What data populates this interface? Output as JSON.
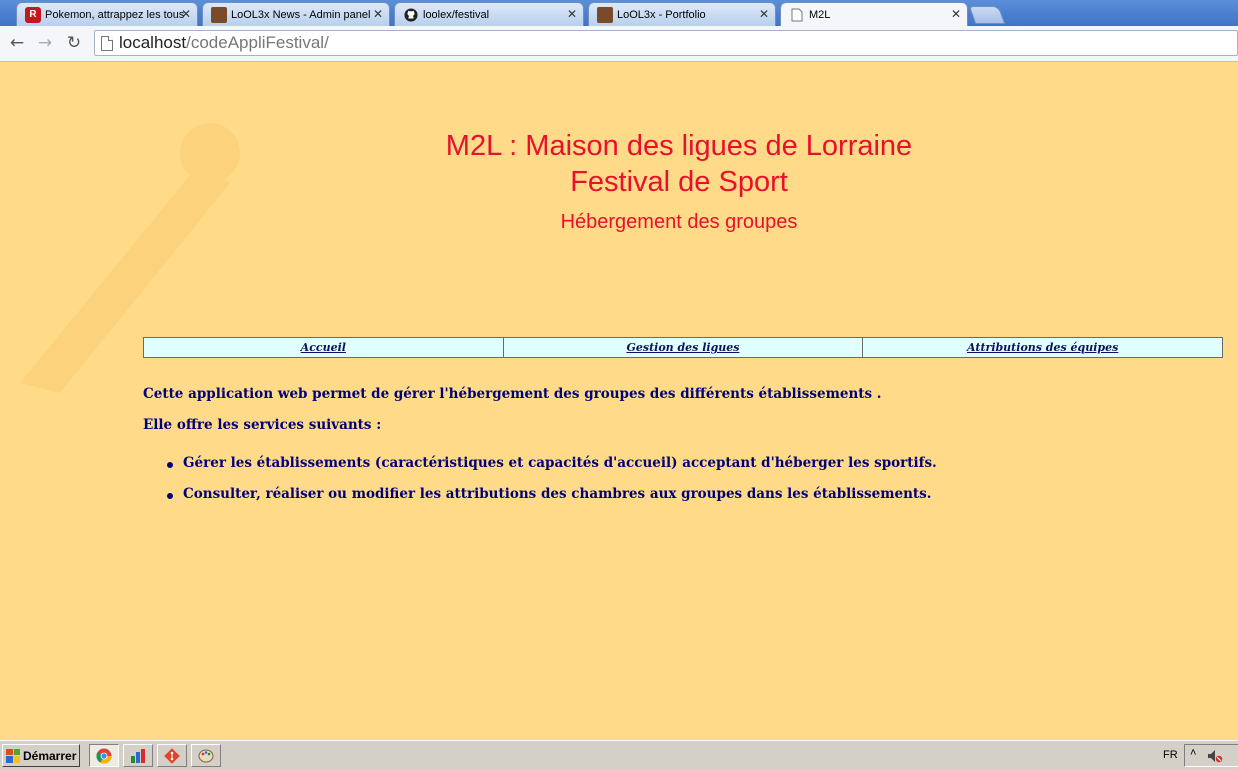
{
  "browser": {
    "tabs": [
      {
        "title": "Pokemon, attrappez les tous",
        "icon": "pokemon-r-icon",
        "active": false
      },
      {
        "title": "LoOL3x News - Admin panel",
        "icon": "avatar-icon",
        "active": false
      },
      {
        "title": "loolex/festival",
        "icon": "github-icon",
        "active": false
      },
      {
        "title": "LoOL3x - Portfolio",
        "icon": "avatar-icon",
        "active": false
      },
      {
        "title": "M2L",
        "icon": "document-icon",
        "active": true
      }
    ],
    "url_host": "localhost",
    "url_path": "/codeAppliFestival/"
  },
  "header": {
    "title_line1": "M2L : Maison des ligues de Lorraine",
    "title_line2": "Festival de Sport",
    "subtitle": "Hébergement des groupes"
  },
  "menu": [
    {
      "label": "Accueil"
    },
    {
      "label": "Gestion des ligues"
    },
    {
      "label": "Attributions des équipes"
    }
  ],
  "content": {
    "intro": "Cette application web permet de gérer l'hébergement des groupes des différents établissements .",
    "services_intro": "Elle offre les services suivants :",
    "services": [
      "Gérer les établissements (caractéristiques et capacités d'accueil) acceptant d'héberger les sportifs.",
      "Consulter, réaliser ou modifier les attributions des chambres aux groupes dans les établissements."
    ]
  },
  "taskbar": {
    "start_label": "Démarrer",
    "language": "FR"
  },
  "colors": {
    "page_background": "#ffda88",
    "title_red": "#e8112d",
    "text_navy": "#00007a",
    "menu_cell": "#e0ffff"
  }
}
